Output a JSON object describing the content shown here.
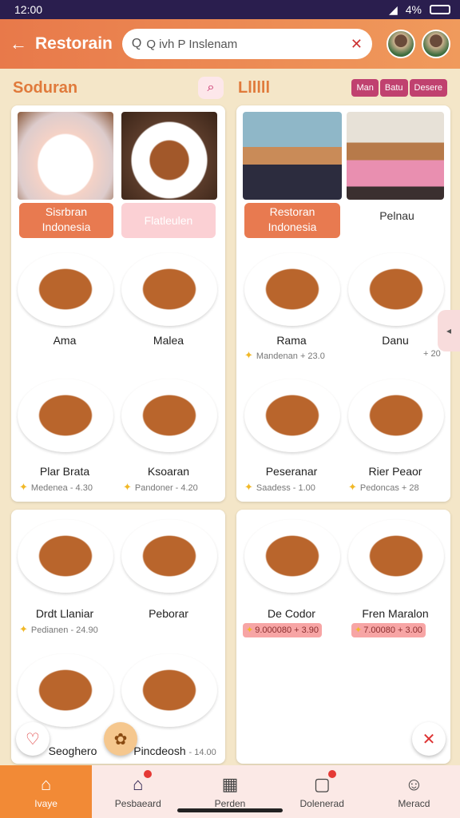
{
  "status_bar": {
    "time": "12:00",
    "battery": "4%"
  },
  "app_bar": {
    "title": "Restorain",
    "search_value": "Q ivh P Inslenam",
    "back_icon": "arrow-left-icon",
    "clear_icon": "close-icon"
  },
  "sections": {
    "left_title": "Soduran",
    "right_title": "Llllll",
    "right_chips": [
      "Man",
      "Batu",
      "Desere"
    ]
  },
  "card_top_left": {
    "tags": [
      "Sisrbran\nIndonesia",
      "Flatleulen"
    ],
    "dishes": [
      {
        "name": "Ama",
        "price": ""
      },
      {
        "name": "Malea",
        "price": ""
      },
      {
        "name": "Plar Brata",
        "price": "Medenea  - 4.30"
      },
      {
        "name": "Ksoaran",
        "price": "Pandoner  - 4.20"
      }
    ]
  },
  "card_top_right": {
    "tags": [
      "Restoran\nIndonesia",
      "Pelnau"
    ],
    "dishes": [
      {
        "name": "Rama",
        "price": "Mandenan  + 23.0"
      },
      {
        "name": "Danu",
        "price": "+ 20"
      },
      {
        "name": "Peseranar",
        "price": "Saadess  - 1.00"
      },
      {
        "name": "Rier Peaor",
        "price": "Pedoncas  + 28"
      }
    ]
  },
  "card_bottom_left": {
    "dishes": [
      {
        "name": "Drdt Llaniar",
        "price": "Pedianen  - 24.90"
      },
      {
        "name": "Peborar",
        "price": ""
      },
      {
        "name": "Seoghero",
        "price": ""
      },
      {
        "name": "Pincdeosh",
        "price": "- 14.00"
      }
    ]
  },
  "card_bottom_right": {
    "dishes": [
      {
        "name": "De Codor",
        "price": "9.000080  + 3.90"
      },
      {
        "name": "Fren Maralon",
        "price": "7.00080  + 3.00"
      }
    ]
  },
  "bottom_nav": [
    {
      "label": "Ivaye",
      "icon": "home-icon"
    },
    {
      "label": "Pesbaeard",
      "icon": "home-icon"
    },
    {
      "label": "Perden",
      "icon": "store-icon"
    },
    {
      "label": "Dolenerad",
      "icon": "bag-icon"
    },
    {
      "label": "Meracd",
      "icon": "person-icon"
    }
  ],
  "colors": {
    "accent": "#e8794a",
    "status_bar": "#2a1e4e",
    "chip": "#c0416f",
    "nav_active": "#f28a36"
  }
}
